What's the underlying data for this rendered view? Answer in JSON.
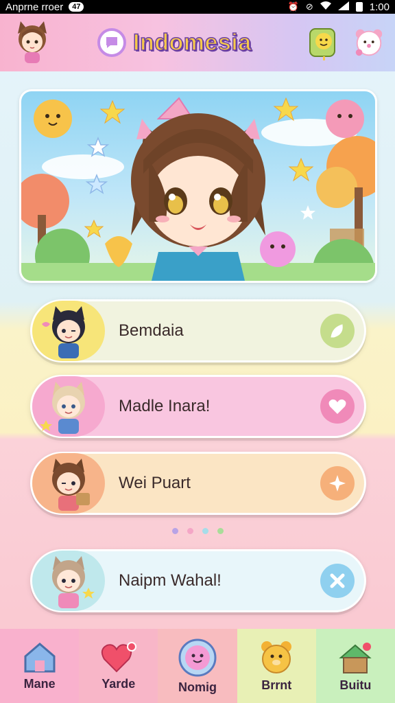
{
  "status_bar": {
    "carrier": "Anprne rroer",
    "badge": "47",
    "time": "1:00"
  },
  "header": {
    "title": "Indomesia",
    "left_avatar": "cat-girl-avatar-icon",
    "right_buttons": [
      "smiley-pet-icon",
      "bear-icon"
    ]
  },
  "cards": [
    {
      "label": "Bemdaia",
      "color": "#f1f3df",
      "char_bg": "#f7e579",
      "action_color": "#c5dd8c",
      "action_icon": "leaf-icon"
    },
    {
      "label": "Madle Inara!",
      "color": "#f9c6e0",
      "char_bg": "#f6a9cf",
      "action_color": "#f08ab9",
      "action_icon": "heart-icon"
    },
    {
      "label": "Wei Puart",
      "color": "#fbe5c4",
      "char_bg": "#f7b48a",
      "action_color": "#f6b07a",
      "action_icon": "sparkle-icon"
    },
    {
      "label": "Naipm Wahal!",
      "color": "#e8f6fa",
      "char_bg": "#bfe8ec",
      "action_color": "#8fd0ef",
      "action_icon": "close-icon"
    }
  ],
  "dots": [
    "#b8a3e6",
    "#f4a6c6",
    "#a6dde9",
    "#a9dd99"
  ],
  "nav": [
    {
      "label": "Mane",
      "bg": "#f9b1cd"
    },
    {
      "label": "Yarde",
      "bg": "#f8b6c8"
    },
    {
      "label": "Nomig",
      "bg": "#f8bcbf"
    },
    {
      "label": "Brrnt",
      "bg": "#e8f0b5"
    },
    {
      "label": "Buitu",
      "bg": "#c9f0bd"
    }
  ]
}
